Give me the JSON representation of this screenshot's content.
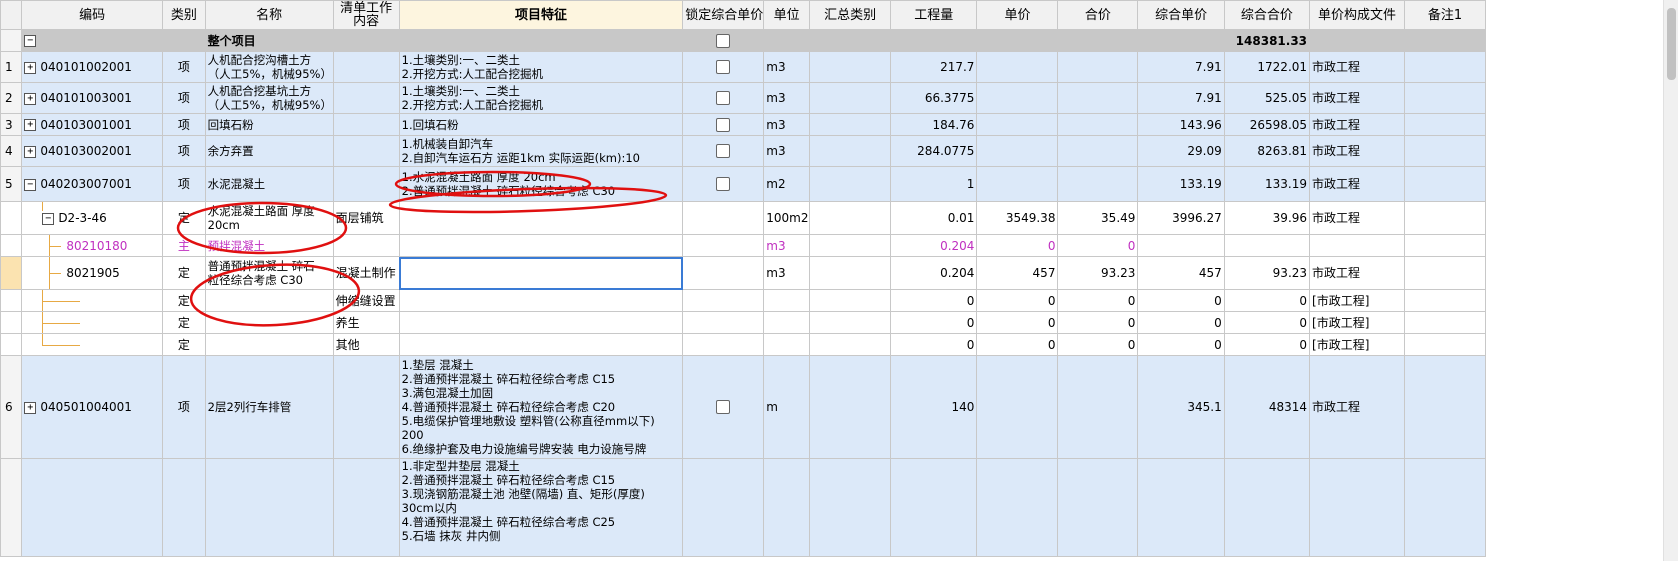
{
  "headers": [
    "",
    "编码",
    "类别",
    "名称",
    "清单工作内容",
    "项目特征",
    "锁定综合单价",
    "单位",
    "汇总类别",
    "工程量",
    "单价",
    "合价",
    "综合单价",
    "综合合价",
    "单价构成文件",
    "备注1"
  ],
  "summary": {
    "toggle": "−",
    "name": "整个项目",
    "total": "148381.33"
  },
  "rows": [
    {
      "no": "1",
      "toggle": "+",
      "code": "040101002001",
      "type": "项",
      "name_lines": [
        "人机配合挖沟槽土方",
        "（人工5%，机械95%）"
      ],
      "content": "",
      "features": [
        "1.土壤类别:一、二类土",
        "2.开挖方式:人工配合挖掘机"
      ],
      "unit": "m3",
      "qty": "217.7",
      "price": "",
      "amount": "",
      "unit_comp": "7.91",
      "total_comp": "1722.01",
      "file": "市政工程"
    },
    {
      "no": "2",
      "toggle": "+",
      "code": "040101003001",
      "type": "项",
      "name_lines": [
        "人机配合挖基坑土方",
        "（人工5%，机械95%）"
      ],
      "content": "",
      "features": [
        "1.土壤类别:一、二类土",
        "2.开挖方式:人工配合挖掘机"
      ],
      "unit": "m3",
      "qty": "66.3775",
      "price": "",
      "amount": "",
      "unit_comp": "7.91",
      "total_comp": "525.05",
      "file": "市政工程"
    },
    {
      "no": "3",
      "toggle": "+",
      "code": "040103001001",
      "type": "项",
      "name_lines": [
        "回填石粉"
      ],
      "content": "",
      "features": [
        "1.回填石粉"
      ],
      "unit": "m3",
      "qty": "184.76",
      "price": "",
      "amount": "",
      "unit_comp": "143.96",
      "total_comp": "26598.05",
      "file": "市政工程"
    },
    {
      "no": "4",
      "toggle": "+",
      "code": "040103002001",
      "type": "项",
      "name_lines": [
        "余方弃置"
      ],
      "content": "",
      "features": [
        "1.机械装自卸汽车",
        "2.自卸汽车运石方 运距1km  实际运距(km):10"
      ],
      "unit": "m3",
      "qty": "284.0775",
      "price": "",
      "amount": "",
      "unit_comp": "29.09",
      "total_comp": "8263.81",
      "file": "市政工程"
    },
    {
      "no": "5",
      "toggle": "−",
      "code": "040203007001",
      "type": "项",
      "name_lines": [
        "水泥混凝土"
      ],
      "content": "",
      "features": [
        "1.水泥混凝土路面 厚度 20cm",
        "2.普通预拌混凝土 碎石粒径综合考虑 C30"
      ],
      "unit": "m2",
      "qty": "1",
      "price": "",
      "amount": "",
      "unit_comp": "133.19",
      "total_comp": "133.19",
      "file": "市政工程"
    }
  ],
  "sub_rows": [
    {
      "toggle": "−",
      "code": "D2-3-46",
      "type": "定",
      "name_lines": [
        "水泥混凝土路面 厚度",
        "20cm"
      ],
      "content": "面层铺筑",
      "features": [],
      "unit": "100m2",
      "qty": "0.01",
      "price": "3549.38",
      "amount": "35.49",
      "unit_comp": "3996.27",
      "total_comp": "39.96",
      "file": "市政工程"
    },
    {
      "code": "80210180",
      "type": "主",
      "name_lines": [
        "预拌混凝土"
      ],
      "content": "",
      "unit": "m3",
      "qty": "0.204",
      "price": "0",
      "amount": "0",
      "unit_comp": "",
      "total_comp": "",
      "file": ""
    },
    {
      "code": "8021905",
      "type": "定",
      "name_lines": [
        "普通预拌混凝土 碎石",
        "粒径综合考虑 C30"
      ],
      "content": "混凝土制作",
      "unit": "m3",
      "qty": "0.204",
      "price": "457",
      "amount": "93.23",
      "unit_comp": "457",
      "total_comp": "93.23",
      "file": "市政工程"
    },
    {
      "code": "",
      "type": "定",
      "name_lines": [],
      "content": "伸缩缝设置",
      "unit": "",
      "qty": "0",
      "price": "0",
      "amount": "0",
      "unit_comp": "0",
      "total_comp": "0",
      "file": "[市政工程]"
    },
    {
      "code": "",
      "type": "定",
      "name_lines": [],
      "content": "养生",
      "unit": "",
      "qty": "0",
      "price": "0",
      "amount": "0",
      "unit_comp": "0",
      "total_comp": "0",
      "file": "[市政工程]"
    },
    {
      "code": "",
      "type": "定",
      "name_lines": [],
      "content": "其他",
      "unit": "",
      "qty": "0",
      "price": "0",
      "amount": "0",
      "unit_comp": "0",
      "total_comp": "0",
      "file": "[市政工程]"
    }
  ],
  "row6": {
    "no": "6",
    "toggle": "+",
    "code": "040501004001",
    "type": "项",
    "name_lines": [
      "2层2列行车排管"
    ],
    "features": [
      "1.垫层 混凝土",
      "2.普通预拌混凝土 碎石粒径综合考虑 C15",
      "3.满包混凝土加固",
      "4.普通预拌混凝土 碎石粒径综合考虑 C20",
      "5.电缆保护管埋地敷设 塑料管(公称直径mm以下)",
      "200",
      "6.绝缘护套及电力设施编号牌安装 电力设施号牌"
    ],
    "unit": "m",
    "qty": "140",
    "unit_comp": "345.1",
    "total_comp": "48314",
    "file": "市政工程"
  },
  "row7": {
    "features": [
      "1.非定型井垫层 混凝土",
      "2.普通预拌混凝土 碎石粒径综合考虑 C15",
      "3.现浇钢筋混凝土池 池壁(隔墙) 直、矩形(厚度)",
      "30cm以内",
      "4.普通预拌混凝土 碎石粒径综合考虑 C25",
      "5.石墙 抹灰 井内侧"
    ]
  },
  "colors": {
    "row_blue": "#dce9f9",
    "summary_gray": "#c8c8c8",
    "annotation_red": "#e01010",
    "tree_line": "#e7a944",
    "material_pink": "#c030c0",
    "selection_blue": "#3a7bd5"
  }
}
